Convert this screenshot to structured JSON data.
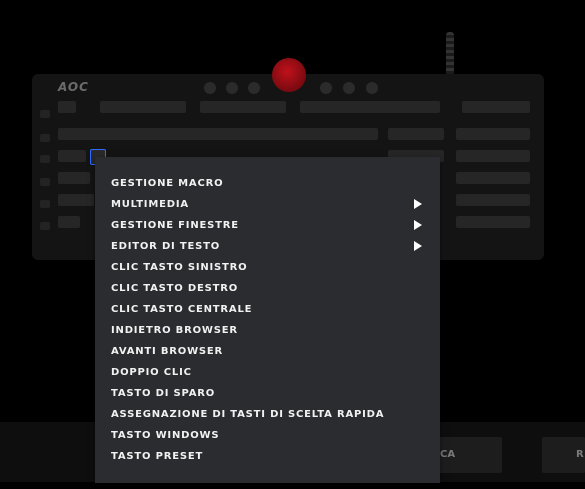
{
  "keyboard": {
    "brand": "AOC"
  },
  "bottom": {
    "button_left_partial": "CA",
    "button_right_partial": "R"
  },
  "menu": {
    "items": [
      {
        "label": "GESTIONE MACRO",
        "submenu": false
      },
      {
        "label": "MULTIMEDIA",
        "submenu": true
      },
      {
        "label": "GESTIONE FINESTRE",
        "submenu": true
      },
      {
        "label": "EDITOR DI TESTO",
        "submenu": true
      },
      {
        "label": "CLIC TASTO SINISTRO",
        "submenu": false
      },
      {
        "label": "CLIC TASTO DESTRO",
        "submenu": false
      },
      {
        "label": "CLIC TASTO CENTRALE",
        "submenu": false
      },
      {
        "label": "INDIETRO BROWSER",
        "submenu": false
      },
      {
        "label": "AVANTI BROWSER",
        "submenu": false
      },
      {
        "label": "DOPPIO CLIC",
        "submenu": false
      },
      {
        "label": "TASTO DI SPARO",
        "submenu": false
      },
      {
        "label": "ASSEGNAZIONE DI TASTI DI SCELTA RAPIDA",
        "submenu": false
      },
      {
        "label": "TASTO WINDOWS",
        "submenu": false
      },
      {
        "label": "TASTO PRESET",
        "submenu": false
      }
    ]
  }
}
